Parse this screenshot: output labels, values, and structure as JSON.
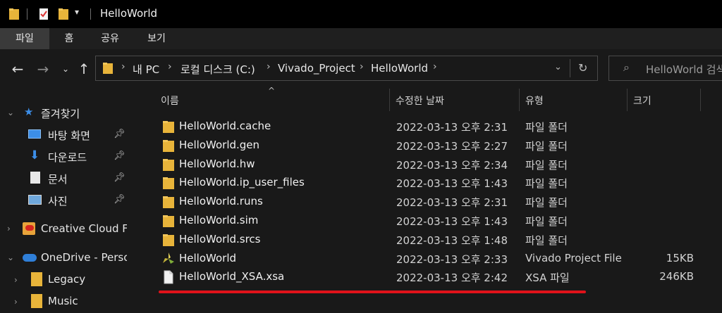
{
  "window": {
    "title": "HelloWorld"
  },
  "ribbon": {
    "tabs": [
      "파일",
      "홈",
      "공유",
      "보기"
    ]
  },
  "address": {
    "crumbs": [
      "내 PC",
      "로컬 디스크 (C:)",
      "Vivado_Project",
      "HelloWorld"
    ]
  },
  "search": {
    "placeholder": "HelloWorld 검색"
  },
  "sidebar": {
    "quick_access": "즐겨찾기",
    "items": [
      {
        "label": "바탕 화면",
        "icon": "desktop-icon"
      },
      {
        "label": "다운로드",
        "icon": "download-icon"
      },
      {
        "label": "문서",
        "icon": "documents-icon"
      },
      {
        "label": "사진",
        "icon": "pictures-icon"
      }
    ],
    "creative_cloud": "Creative Cloud Files",
    "onedrive": "OneDrive - Personal",
    "onedrive_items": [
      "Legacy",
      "Music"
    ]
  },
  "columns": {
    "name": "이름",
    "date": "수정한 날짜",
    "type": "유형",
    "size": "크기"
  },
  "files": [
    {
      "name": "HelloWorld.cache",
      "date": "2022-03-13 오후 2:31",
      "type": "파일 폴더",
      "size": "",
      "icon": "folder-icon"
    },
    {
      "name": "HelloWorld.gen",
      "date": "2022-03-13 오후 2:27",
      "type": "파일 폴더",
      "size": "",
      "icon": "folder-icon"
    },
    {
      "name": "HelloWorld.hw",
      "date": "2022-03-13 오후 2:34",
      "type": "파일 폴더",
      "size": "",
      "icon": "folder-icon"
    },
    {
      "name": "HelloWorld.ip_user_files",
      "date": "2022-03-13 오후 1:43",
      "type": "파일 폴더",
      "size": "",
      "icon": "folder-icon"
    },
    {
      "name": "HelloWorld.runs",
      "date": "2022-03-13 오후 2:31",
      "type": "파일 폴더",
      "size": "",
      "icon": "folder-icon"
    },
    {
      "name": "HelloWorld.sim",
      "date": "2022-03-13 오후 1:43",
      "type": "파일 폴더",
      "size": "",
      "icon": "folder-icon"
    },
    {
      "name": "HelloWorld.srcs",
      "date": "2022-03-13 오후 1:48",
      "type": "파일 폴더",
      "size": "",
      "icon": "folder-icon"
    },
    {
      "name": "HelloWorld",
      "date": "2022-03-13 오후 2:33",
      "type": "Vivado Project File",
      "size": "15KB",
      "icon": "vivado-icon"
    },
    {
      "name": "HelloWorld_XSA.xsa",
      "date": "2022-03-13 오후 2:42",
      "type": "XSA 파일",
      "size": "246KB",
      "icon": "file-icon"
    }
  ],
  "colors": {
    "folder": "#e8b43a",
    "accent": "#3c8ee8",
    "highlight": "#e0121a",
    "vivado": "#c4b43a"
  }
}
